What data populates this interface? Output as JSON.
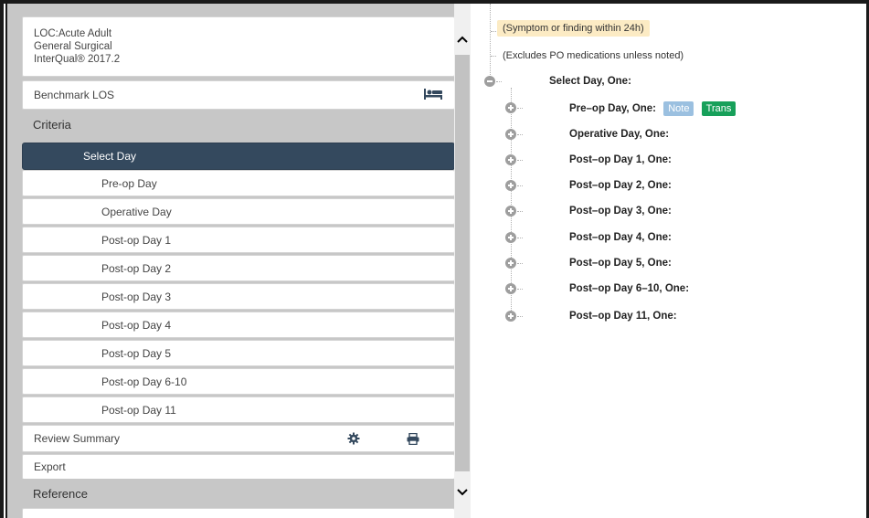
{
  "left_panel": {
    "loc_lines": [
      "LOC:Acute Adult",
      "General Surgical",
      "InterQual® 2017.2"
    ],
    "benchmark_label": "Benchmark LOS",
    "criteria_header": "Criteria",
    "selected_item": "Select Day",
    "days": [
      "Pre-op Day",
      "Operative Day",
      "Post-op Day 1",
      "Post-op Day 2",
      "Post-op Day 3",
      "Post-op Day 4",
      "Post-op Day 5",
      "Post-op Day 6-10",
      "Post-op Day 11"
    ],
    "review_summary_label": "Review Summary",
    "export_label": "Export",
    "reference_header": "Reference"
  },
  "right_panel": {
    "note_highlighted": "(Symptom or finding within 24h)",
    "note_plain": "(Excludes PO medications unless noted)",
    "root_label": "Select Day, One:",
    "children": [
      "Pre–op Day, One:",
      "Operative Day, One:",
      "Post–op Day 1, One:",
      "Post–op Day 2, One:",
      "Post–op Day 3, One:",
      "Post–op Day 4, One:",
      "Post–op Day 5, One:",
      "Post–op Day 6–10, One:",
      "Post–op Day 11, One:"
    ],
    "badges": {
      "note": "Note",
      "trans": "Trans"
    }
  },
  "icons": {
    "bed": "bed-icon",
    "gear": "gear-icon",
    "printer": "printer-icon",
    "expand": "plus-circle-icon",
    "collapse": "minus-circle-icon"
  },
  "colors": {
    "selected_bg": "#34495e",
    "note_badge": "#9bc0e0",
    "trans_badge": "#17a05a",
    "highlight": "#fcebc4"
  }
}
